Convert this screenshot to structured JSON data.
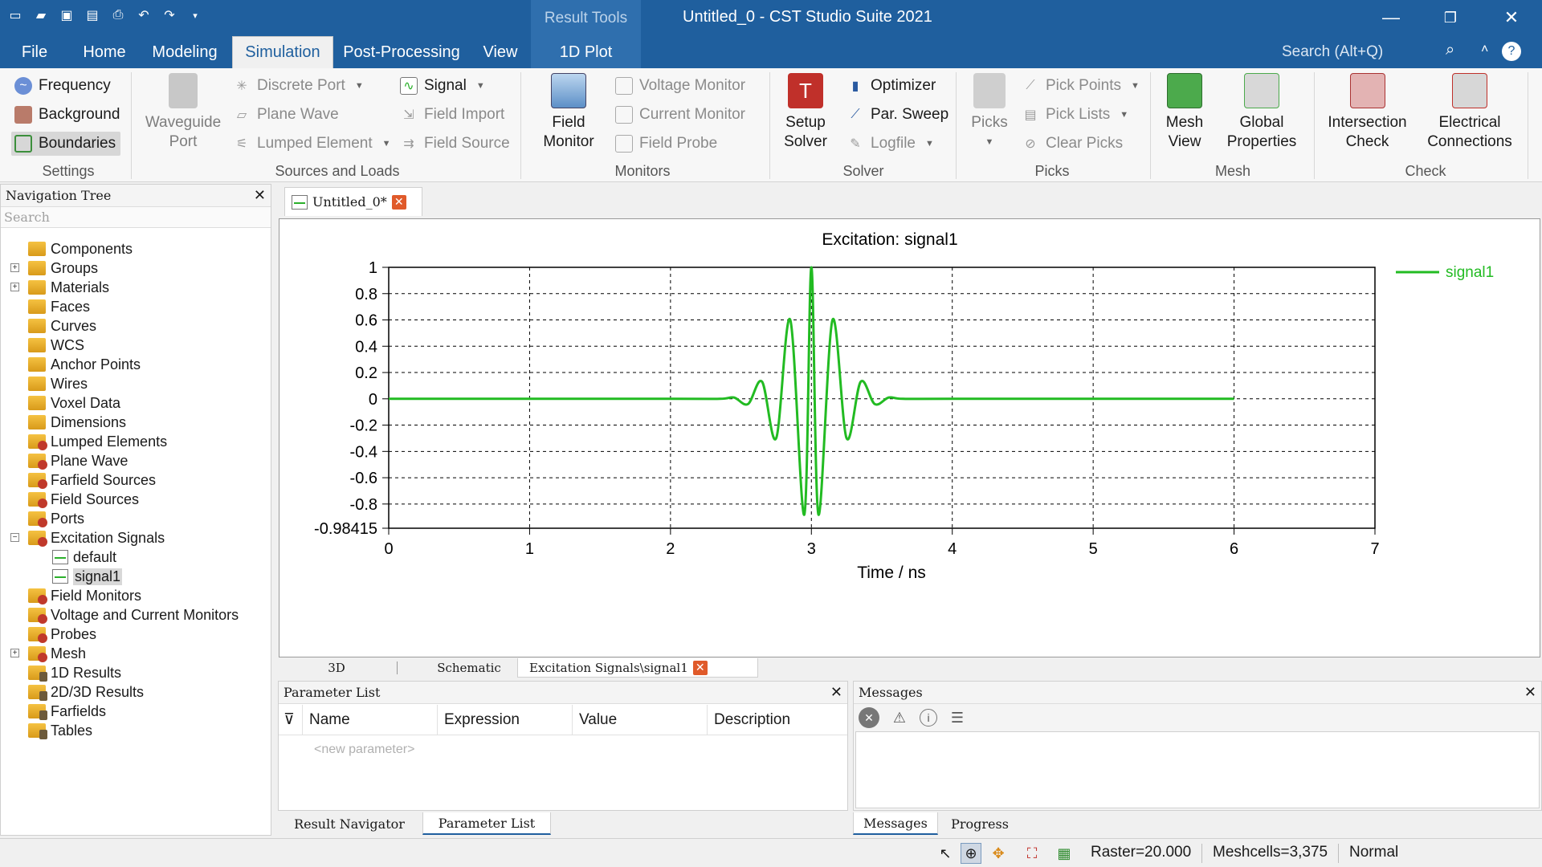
{
  "window": {
    "title": "Untitled_0 - CST Studio Suite 2021",
    "context_tab_group": "Result Tools"
  },
  "menu_tabs": [
    "File",
    "Home",
    "Modeling",
    "Simulation",
    "Post-Processing",
    "View",
    "1D Plot"
  ],
  "active_tab": "Simulation",
  "search": {
    "placeholder": "Search (Alt+Q)"
  },
  "ribbon": {
    "settings": {
      "label": "Settings",
      "frequency": "Frequency",
      "background": "Background",
      "boundaries": "Boundaries"
    },
    "sources": {
      "label": "Sources and Loads",
      "waveguide_port": "Waveguide Port",
      "discrete_port": "Discrete Port",
      "plane_wave": "Plane Wave",
      "lumped_element": "Lumped Element",
      "signal": "Signal",
      "field_import": "Field Import",
      "field_source": "Field Source"
    },
    "monitors": {
      "label": "Monitors",
      "field_monitor": "Field Monitor",
      "voltage_monitor": "Voltage Monitor",
      "current_monitor": "Current Monitor",
      "field_probe": "Field Probe"
    },
    "solver": {
      "label": "Solver",
      "setup_solver": "Setup Solver",
      "optimizer": "Optimizer",
      "par_sweep": "Par. Sweep",
      "logfile": "Logfile"
    },
    "picks": {
      "label": "Picks",
      "picks": "Picks",
      "pick_points": "Pick Points",
      "pick_lists": "Pick Lists",
      "clear_picks": "Clear Picks"
    },
    "mesh": {
      "label": "Mesh",
      "mesh_view": "Mesh View",
      "global_properties": "Global Properties"
    },
    "check": {
      "label": "Check",
      "intersection_check": "Intersection Check",
      "electrical_connections": "Electrical Connections"
    }
  },
  "navigation_tree": {
    "title": "Navigation Tree",
    "search_placeholder": "Search",
    "items": [
      {
        "label": "Components",
        "icon": "folder-icon"
      },
      {
        "label": "Groups",
        "icon": "folder-icon"
      },
      {
        "label": "Materials",
        "icon": "folder-icon"
      },
      {
        "label": "Faces",
        "icon": "folder-icon"
      },
      {
        "label": "Curves",
        "icon": "folder-icon"
      },
      {
        "label": "WCS",
        "icon": "folder-icon"
      },
      {
        "label": "Anchor Points",
        "icon": "folder-icon"
      },
      {
        "label": "Wires",
        "icon": "folder-icon"
      },
      {
        "label": "Voxel Data",
        "icon": "folder-icon"
      },
      {
        "label": "Dimensions",
        "icon": "folder-icon"
      },
      {
        "label": "Lumped Elements",
        "icon": "folder-icon"
      },
      {
        "label": "Plane Wave",
        "icon": "folder-icon"
      },
      {
        "label": "Farfield Sources",
        "icon": "folder-icon"
      },
      {
        "label": "Field Sources",
        "icon": "folder-icon"
      },
      {
        "label": "Ports",
        "icon": "folder-icon"
      },
      {
        "label": "Excitation Signals",
        "icon": "folder-icon"
      },
      {
        "label": "default",
        "icon": "signal-icon"
      },
      {
        "label": "signal1",
        "icon": "signal-icon"
      },
      {
        "label": "Field Monitors",
        "icon": "folder-icon"
      },
      {
        "label": "Voltage and Current Monitors",
        "icon": "folder-icon"
      },
      {
        "label": "Probes",
        "icon": "folder-icon"
      },
      {
        "label": "Mesh",
        "icon": "folder-icon"
      },
      {
        "label": "1D Results",
        "icon": "results-icon"
      },
      {
        "label": "2D/3D Results",
        "icon": "results-icon"
      },
      {
        "label": "Farfields",
        "icon": "results-icon"
      },
      {
        "label": "Tables",
        "icon": "results-icon"
      }
    ],
    "selected": "signal1"
  },
  "document_tab": {
    "label": "Untitled_0*"
  },
  "view_tabs": [
    "3D",
    "Schematic",
    "Excitation Signals\\signal1"
  ],
  "active_view_tab": "Excitation Signals\\signal1",
  "chart_data": {
    "type": "line",
    "title": "Excitation: signal1",
    "xlabel": "Time / ns",
    "ylabel": "",
    "xlim": [
      0,
      7
    ],
    "ylim": [
      -0.98415,
      1
    ],
    "x_ticks": [
      "0",
      "1",
      "2",
      "3",
      "4",
      "5",
      "6",
      "7"
    ],
    "y_ticks": [
      "1",
      "0.8",
      "0.6",
      "0.4",
      "0.2",
      "0",
      "-0.2",
      "-0.4",
      "-0.6",
      "-0.8",
      "-0.98415"
    ],
    "grid": true,
    "legend": "top-right",
    "series": [
      {
        "name": "signal1",
        "color": "#22bb22",
        "x": [
          0,
          2.0,
          2.35,
          2.45,
          2.55,
          2.65,
          2.75,
          2.85,
          2.95,
          3.0,
          3.05,
          3.15,
          3.25,
          3.35,
          3.45,
          3.55,
          3.65,
          4.0,
          6.0
        ],
        "y": [
          0,
          0,
          0,
          0.01,
          -0.04,
          0.13,
          -0.3,
          0.6,
          -0.88,
          1.0,
          -0.88,
          0.6,
          -0.3,
          0.13,
          -0.04,
          0.01,
          0,
          0,
          0
        ]
      }
    ]
  },
  "parameter_list": {
    "title": "Parameter List",
    "columns": [
      "Name",
      "Expression",
      "Value",
      "Description"
    ],
    "new_row_placeholder": "<new parameter>"
  },
  "messages": {
    "title": "Messages"
  },
  "bottom_tabs_left": [
    "Result Navigator",
    "Parameter List"
  ],
  "bottom_tabs_right": [
    "Messages",
    "Progress"
  ],
  "status_bar": {
    "raster": "Raster=20.000",
    "meshcells": "Meshcells=3,375",
    "mode": "Normal"
  },
  "colors": {
    "titlebar": "#1f5f9e",
    "signal": "#22bb22",
    "close_icon": "#e05a2a"
  }
}
